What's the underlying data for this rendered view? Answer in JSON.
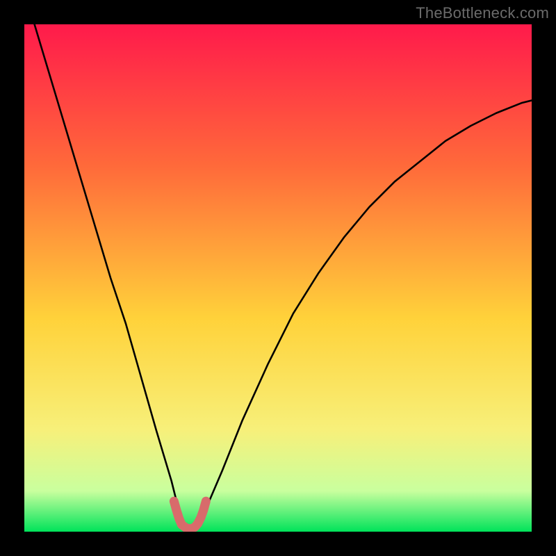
{
  "watermark": "TheBottleneck.com",
  "colors": {
    "bg_black": "#000000",
    "grad_top": "#ff1a4b",
    "grad_mid_upper": "#ff6a3a",
    "grad_mid": "#ffd23a",
    "grad_mid_lower": "#f7f07a",
    "grad_green_pale": "#c9ff9e",
    "grad_green": "#00e35a",
    "curve": "#000000",
    "highlight": "#d86b6b"
  },
  "chart_data": {
    "type": "line",
    "title": "",
    "xlabel": "",
    "ylabel": "",
    "xlim": [
      0,
      100
    ],
    "ylim": [
      0,
      100
    ],
    "grid": false,
    "legend": false,
    "annotations": [],
    "series": [
      {
        "name": "curve",
        "x": [
          2,
          5,
          8,
          11,
          14,
          17,
          20,
          22,
          24,
          26,
          27.5,
          29,
          30,
          30.8,
          31.4,
          32,
          32.5,
          33,
          33.5,
          34,
          36,
          39,
          43,
          48,
          53,
          58,
          63,
          68,
          73,
          78,
          83,
          88,
          93,
          98,
          100
        ],
        "y": [
          100,
          90,
          80,
          70,
          60,
          50,
          41,
          34,
          27,
          20,
          15,
          10,
          6,
          3,
          1.5,
          0.8,
          0.6,
          0.6,
          0.8,
          1.5,
          5,
          12,
          22,
          33,
          43,
          51,
          58,
          64,
          69,
          73,
          77,
          80,
          82.5,
          84.5,
          85
        ]
      },
      {
        "name": "highlight",
        "x": [
          29.5,
          30,
          30.5,
          31,
          31.8,
          32.3,
          33,
          33.6,
          34.2,
          34.8,
          35.3,
          35.8
        ],
        "y": [
          6,
          4.2,
          2.6,
          1.4,
          0.8,
          0.6,
          0.6,
          0.9,
          1.6,
          2.8,
          4.2,
          6
        ]
      }
    ],
    "gradient_stops": [
      {
        "pct": 0,
        "color": "#ff1a4b"
      },
      {
        "pct": 28,
        "color": "#ff6a3a"
      },
      {
        "pct": 58,
        "color": "#ffd23a"
      },
      {
        "pct": 80,
        "color": "#f7f07a"
      },
      {
        "pct": 92,
        "color": "#c9ff9e"
      },
      {
        "pct": 100,
        "color": "#00e35a"
      }
    ],
    "minimum_x": 32.7,
    "highlight_x_range": [
      29.5,
      35.8
    ]
  }
}
